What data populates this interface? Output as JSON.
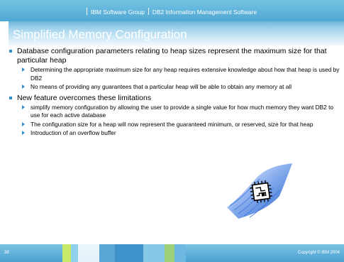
{
  "header": {
    "company": "IBM Software Group",
    "division": "DB2 Information Management Software"
  },
  "title": "Simplified Memory Configuration",
  "bullets": [
    {
      "text": "Database configuration parameters relating to heap sizes represent the maximum size for that particular heap",
      "sub": [
        "Determining the appropriate maximum size for any heap requires extensive knowledge about how that heap is used by DB2",
        "No means of providing any guarantees that a particular heap will be able to obtain any memory at all"
      ]
    },
    {
      "text": "New feature overcomes these limitations",
      "sub": [
        "simplify memory configuration by allowing the user to provide a single value for how much memory they want DB2 to use for each active database",
        "The configuration size for a heap will now represent the guaranteed minimum, or reserved, size for that heap",
        "Introduction of an overflow buffer"
      ]
    }
  ],
  "footer": {
    "page_number": "38",
    "copyright": "Copyright © IBM 2004"
  },
  "colors": {
    "header_blue": "#4fa8d4",
    "title_blue": "#6fb6dd",
    "bullet_blue": "#2f8fd0",
    "chip_blue": "#1f5fcc"
  },
  "icons": {
    "chip": "microchip-illustration"
  }
}
